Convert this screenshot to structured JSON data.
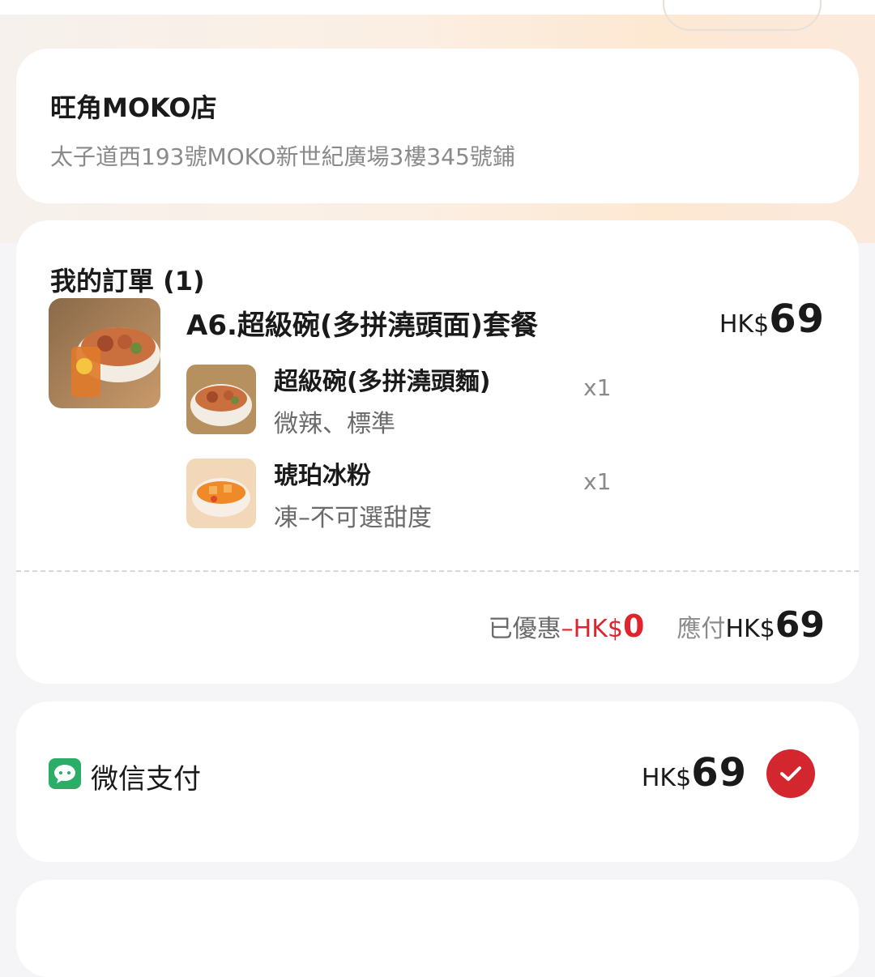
{
  "store": {
    "name": "旺角MOKO店",
    "address": "太子道西193號MOKO新世紀廣場3樓345號鋪"
  },
  "order": {
    "title": "我的訂單 (1)",
    "item": {
      "name": "A6.超級碗(多拼澆頭面)套餐",
      "price_currency": "HK$",
      "price_value": "69",
      "thumb_icon": "noodle-set-image"
    },
    "sub_items": [
      {
        "name": "超級碗(多拼澆頭麵)",
        "options": "微辣、標準",
        "qty": "x1",
        "thumb_icon": "noodle-bowl-image"
      },
      {
        "name": "琥珀冰粉",
        "options": "凍–不可選甜度",
        "qty": "x1",
        "thumb_icon": "jelly-dessert-image"
      }
    ],
    "discount_label": "已優惠",
    "discount_currency": "–HK$",
    "discount_value": "0",
    "payable_label": "應付",
    "payable_currency": "HK$",
    "payable_value": "69"
  },
  "payment": {
    "method_label": "微信支付",
    "method_icon": "wechat-pay-icon",
    "amount_currency": "HK$",
    "amount_value": "69",
    "selected": true,
    "selected_icon": "check-circle-icon"
  },
  "colors": {
    "accent_red": "#d4262f",
    "discount_red": "#e0242e",
    "wechat_green": "#2aae67"
  }
}
